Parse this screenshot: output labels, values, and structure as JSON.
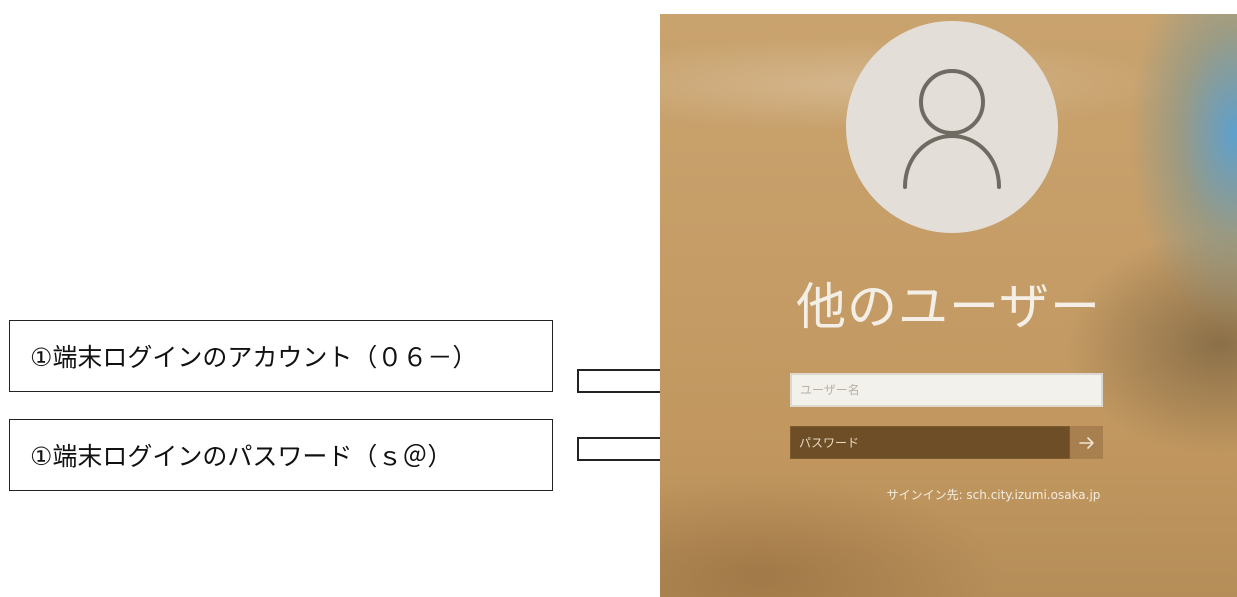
{
  "annotations": {
    "account_label": "①端末ログインのアカウント（０６－）",
    "password_label": "①端末ログインのパスワード（ｓ＠）"
  },
  "login": {
    "user_display_name": "他のユーザー",
    "username_placeholder": "ユーザー名",
    "password_placeholder": "パスワード",
    "submit_icon": "arrow-right-icon",
    "signin_domain": "サインイン先: sch.city.izumi.osaka.jp"
  },
  "colors": {
    "background_tan": "#c59c66",
    "password_field": "#6e4e26",
    "submit_button": "#a8804f",
    "avatar_circle": "#e3dfd8",
    "avatar_glyph": "#6f6a62"
  }
}
